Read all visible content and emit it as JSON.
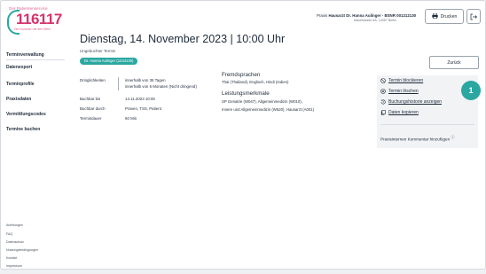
{
  "logo": {
    "top": "Der Patientenservice",
    "number": "116117",
    "sub": "Die Nummer mit den Elfen"
  },
  "sidebar": {
    "items": [
      {
        "label": "Terminverwaltung"
      },
      {
        "label": "Datenexport"
      },
      {
        "label": "Terminprofile"
      },
      {
        "label": "Praxisdaten"
      },
      {
        "label": "Vermittlungscodes"
      },
      {
        "label": "Termine buchen"
      }
    ],
    "footer": [
      "Anleitungen",
      "FAQ",
      "Datenschutz",
      "Nutzungsbedingungen",
      "Kontakt",
      "Impressum"
    ]
  },
  "header": {
    "praxis_prefix": "Praxis",
    "praxis_name": "Hausarzt Dr. Hanna Aulinger - BSNR 001212130",
    "address": "Mauerstraße 6A, 14057 Berlin",
    "print_label": "Drucken"
  },
  "main": {
    "title": "Dienstag, 14. November 2023 | 10:00 Uhr",
    "subtitle": "Ungebuchter Termin",
    "doctor_pill": "Dr. Hanna Aulinger (1234130)",
    "back_label": "Zurück",
    "details": [
      {
        "label": "Dringlichkeiten",
        "values": [
          "innerhalb von 35 Tagen",
          "innerhalb von 6 Monaten (Nicht dringend)"
        ]
      },
      {
        "label": "Buchbar bis",
        "values": [
          "14.11.2023 10:00"
        ]
      },
      {
        "label": "Buchbar durch",
        "values": [
          "Praxen, TSS, Patient"
        ]
      },
      {
        "label": "Termindauer",
        "values": [
          "60 Min"
        ]
      }
    ],
    "languages_title": "Fremdsprachen",
    "languages": "Thai (Thailand), Englisch, Hindi (Indien)",
    "services_title": "Leistungsmerkmale",
    "services_line1": "SP Geriatrie (W047), Allgemeinmedizin (W010),",
    "services_line2": "Innere und Allgemeinmedizin (W520), Hausarzt (A001)"
  },
  "actions": {
    "items": [
      {
        "label": "Termin blockieren",
        "icon": "block-icon"
      },
      {
        "label": "Termin löschen",
        "icon": "delete-circle-icon"
      },
      {
        "label": "Buchungshistorie anzeigen",
        "icon": "history-icon"
      },
      {
        "label": "Daten kopieren",
        "icon": "copy-icon"
      }
    ],
    "comment": "Praxisinternen Kommentar hinzufügen"
  },
  "badge": "1",
  "colors": {
    "accent": "#2aa7a0",
    "brand": "#d6336c",
    "panel": "#f1f3f5"
  }
}
